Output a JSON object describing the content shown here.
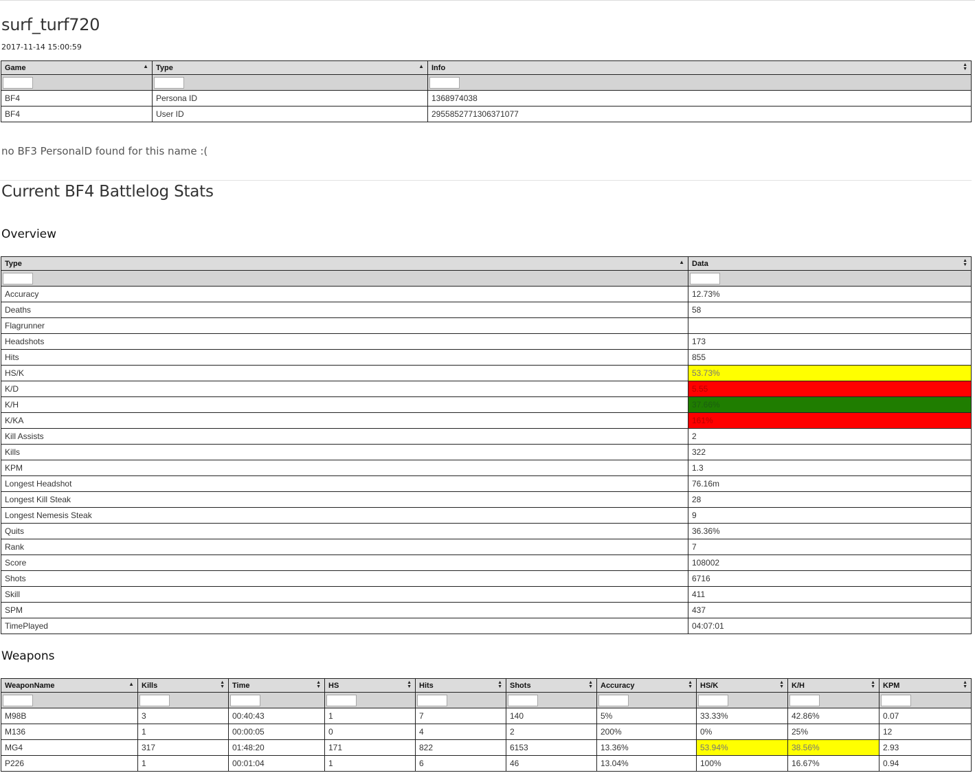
{
  "page": {
    "title": "surf_turf720",
    "timestamp": "2017-11-14 15:00:59",
    "no_bf3_message": "no BF3 PersonalD found for this name :(",
    "section_title": "Current BF4 Battlelog Stats",
    "overview_title": "Overview",
    "weapons_title": "Weapons"
  },
  "icons": {
    "sort_asc": "sort-ascending-icon",
    "sort_both": "sort-both-icon"
  },
  "colors": {
    "yellow": "#ffff00",
    "red": "#ff0000",
    "green": "#1f7d00"
  },
  "ids_table": {
    "headers": [
      {
        "label": "Game",
        "sort": "asc"
      },
      {
        "label": "Type",
        "sort": "asc"
      },
      {
        "label": "Info",
        "sort": "both"
      }
    ],
    "rows": [
      {
        "cells": [
          "BF4",
          "Persona ID",
          "1368974038"
        ]
      },
      {
        "cells": [
          "BF4",
          "User ID",
          "2955852771306371077"
        ]
      }
    ]
  },
  "overview_table": {
    "headers": [
      {
        "label": "Type",
        "sort": "asc"
      },
      {
        "label": "Data",
        "sort": "both"
      }
    ],
    "rows": [
      {
        "cells": [
          "Accuracy",
          "12.73%"
        ]
      },
      {
        "cells": [
          "Deaths",
          "58"
        ]
      },
      {
        "cells": [
          "Flagrunner",
          ""
        ]
      },
      {
        "cells": [
          "Headshots",
          "173"
        ]
      },
      {
        "cells": [
          "Hits",
          "855"
        ]
      },
      {
        "cells": [
          "HS/K",
          "53.73%"
        ],
        "highlight": {
          "1": "yellow"
        }
      },
      {
        "cells": [
          "K/D",
          "5.55"
        ],
        "highlight": {
          "1": "red"
        }
      },
      {
        "cells": [
          "K/H",
          "37.66%"
        ],
        "highlight": {
          "1": "green"
        }
      },
      {
        "cells": [
          "K/KA",
          "161%"
        ],
        "highlight": {
          "1": "red"
        }
      },
      {
        "cells": [
          "Kill Assists",
          "2"
        ]
      },
      {
        "cells": [
          "Kills",
          "322"
        ]
      },
      {
        "cells": [
          "KPM",
          "1.3"
        ]
      },
      {
        "cells": [
          "Longest Headshot",
          "76.16m"
        ]
      },
      {
        "cells": [
          "Longest Kill Steak",
          "28"
        ]
      },
      {
        "cells": [
          "Longest Nemesis Steak",
          "9"
        ]
      },
      {
        "cells": [
          "Quits",
          "36.36%"
        ]
      },
      {
        "cells": [
          "Rank",
          "7"
        ]
      },
      {
        "cells": [
          "Score",
          "108002"
        ]
      },
      {
        "cells": [
          "Shots",
          "6716"
        ]
      },
      {
        "cells": [
          "Skill",
          "411"
        ]
      },
      {
        "cells": [
          "SPM",
          "437"
        ]
      },
      {
        "cells": [
          "TimePlayed",
          "04:07:01"
        ]
      }
    ]
  },
  "weapons_table": {
    "headers": [
      {
        "label": "WeaponName",
        "sort": "asc"
      },
      {
        "label": "Kills",
        "sort": "both"
      },
      {
        "label": "Time",
        "sort": "both"
      },
      {
        "label": "HS",
        "sort": "both"
      },
      {
        "label": "Hits",
        "sort": "both"
      },
      {
        "label": "Shots",
        "sort": "both"
      },
      {
        "label": "Accuracy",
        "sort": "both"
      },
      {
        "label": "HS/K",
        "sort": "both"
      },
      {
        "label": "K/H",
        "sort": "both"
      },
      {
        "label": "KPM",
        "sort": "both"
      }
    ],
    "rows": [
      {
        "cells": [
          "M98B",
          "3",
          "00:40:43",
          "1",
          "7",
          "140",
          "5%",
          "33.33%",
          "42.86%",
          "0.07"
        ]
      },
      {
        "cells": [
          "M136",
          "1",
          "00:00:05",
          "0",
          "4",
          "2",
          "200%",
          "0%",
          "25%",
          "12"
        ]
      },
      {
        "cells": [
          "MG4",
          "317",
          "01:48:20",
          "171",
          "822",
          "6153",
          "13.36%",
          "53.94%",
          "38.56%",
          "2.93"
        ],
        "highlight": {
          "7": "yellow",
          "8": "yellow"
        }
      },
      {
        "cells": [
          "P226",
          "1",
          "00:01:04",
          "1",
          "6",
          "46",
          "13.04%",
          "100%",
          "16.67%",
          "0.94"
        ]
      }
    ]
  }
}
